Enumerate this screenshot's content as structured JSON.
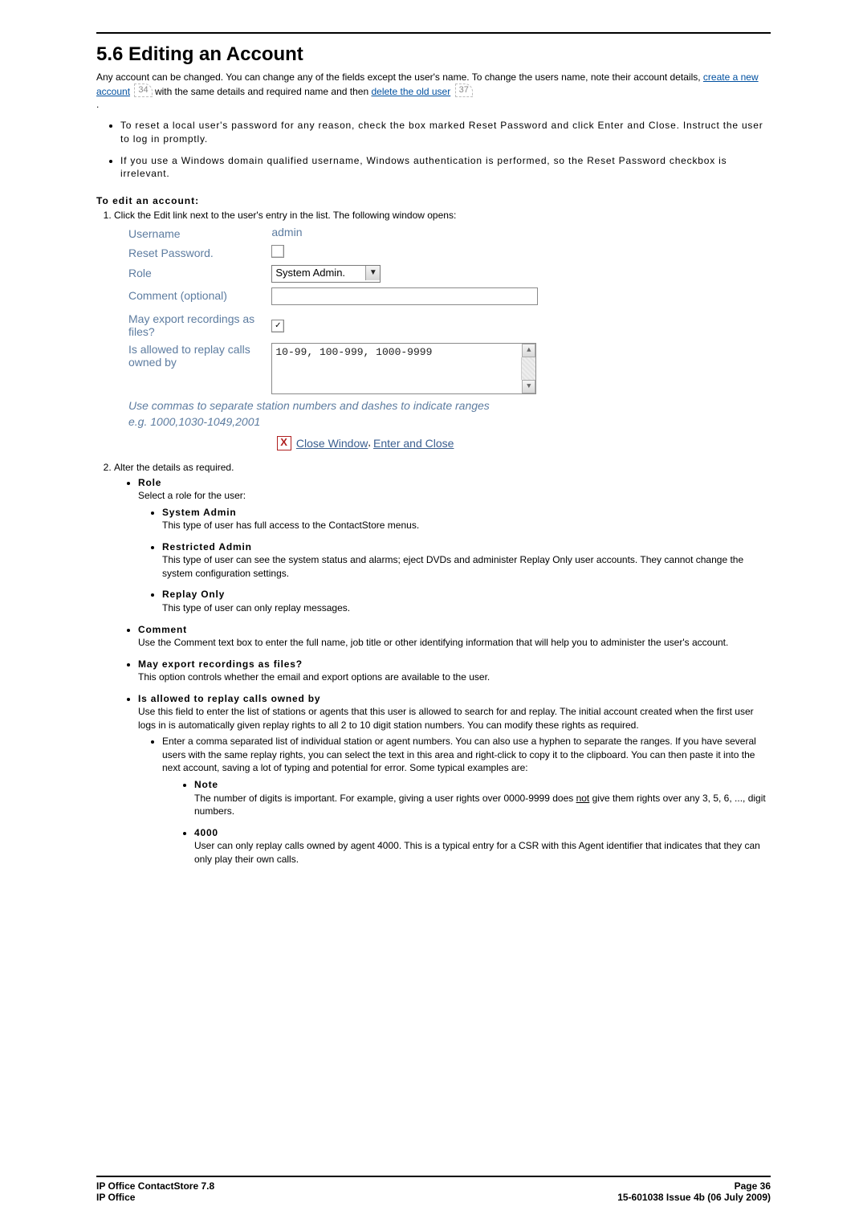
{
  "heading": "5.6 Editing an Account",
  "intro": {
    "part1": "Any account can be changed. You can change any of the fields except the user's name. To change the users name, note their account details, ",
    "link1": "create a new account",
    "xref1": "34",
    "mid": " with the same details and required name and then ",
    "link2": "delete the old user",
    "xref2": "37",
    "end": "."
  },
  "bullets1": [
    "To reset a local user's password for any reason, check the box marked Reset Password and click Enter and Close. Instruct the user to log in promptly.",
    "If you use a Windows domain qualified username, Windows authentication is performed, so the Reset Password checkbox is irrelevant."
  ],
  "edit_heading": "To edit an account:",
  "step1_text": "Click the Edit link next to the user's entry in the list. The following window opens:",
  "dialog": {
    "labels": {
      "username": "Username",
      "reset": "Reset Password.",
      "role": "Role",
      "comment": "Comment (optional)",
      "export": "May export recordings as files?",
      "replay": "Is allowed to replay calls owned by"
    },
    "values": {
      "username": "admin",
      "role_text": "System Admin.",
      "textarea": "10-99, 100-999, 1000-9999"
    },
    "hint1": "Use commas to separate station numbers and dashes to indicate ranges",
    "hint2": "e.g. 1000,1030-1049,2001",
    "footer": {
      "close": "Close Window",
      "sep": ",   ",
      "enter": "Enter and Close"
    }
  },
  "step2_text": "Alter the details as required.",
  "role_intro": "Select a role for the user:",
  "roles": {
    "role_label": "Role",
    "sysadmin_t": "System Admin",
    "sysadmin_d": "This type of user has full access to the ContactStore menus.",
    "restricted_t": "Restricted Admin",
    "restricted_d": "This type of user can see the system status and alarms; eject DVDs and administer Replay Only user accounts. They cannot change the system configuration settings.",
    "replay_t": "Replay Only",
    "replay_d": "This type of user can only replay messages."
  },
  "comment_label": "Comment",
  "comment_d": "Use the Comment text box to enter the full name, job title or other identifying information that will help you to administer the user's account.",
  "export_label": "May export recordings as files?",
  "export_d": "This option controls whether the email and export options are available to the user.",
  "allowed_label": "Is allowed to replay calls owned by",
  "allowed_d": "Use this field to enter the list of stations or agents that this user is allowed to search for and replay. The initial account created when the first user logs in is automatically given replay rights to all 2 to 10 digit station numbers. You can modify these rights as required.",
  "allowed_sub": "Enter a comma separated list of individual station or agent numbers. You can also use a hyphen to separate the ranges. If you have several users with the same replay rights, you can select the text in this area and right-click to copy it to the clipboard. You can then paste it into the next account, saving a lot of typing and potential for error. Some typical examples are:",
  "note_t": "Note",
  "note_d1": "The number of digits is important. For example, giving a user rights over 0000-9999 does ",
  "note_not": "not",
  "note_d2": " give them rights over any 3, 5, 6, ..., digit numbers.",
  "e4000_t": "4000",
  "e4000_d": "User can only replay calls owned by agent 4000. This is a typical entry for a CSR with this Agent identifier that indicates that they can only play their own calls.",
  "footer": {
    "left1": "IP Office ContactStore 7.8",
    "left2": "IP Office",
    "right1": "Page 36",
    "right2": "15-601038 Issue 4b (06 July 2009)"
  }
}
